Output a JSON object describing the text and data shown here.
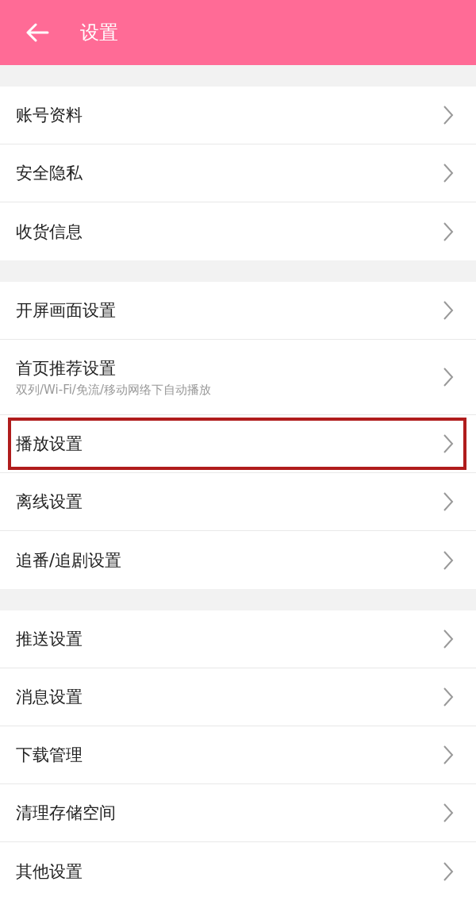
{
  "header": {
    "title": "设置"
  },
  "groups": [
    {
      "items": [
        {
          "label": "账号资料",
          "highlighted": false
        },
        {
          "label": "安全隐私",
          "highlighted": false
        },
        {
          "label": "收货信息",
          "highlighted": false
        }
      ]
    },
    {
      "items": [
        {
          "label": "开屏画面设置",
          "highlighted": false
        },
        {
          "label": "首页推荐设置",
          "subtitle": "双列/Wi-Fi/免流/移动网络下自动播放",
          "highlighted": false
        },
        {
          "label": "播放设置",
          "highlighted": true
        },
        {
          "label": "离线设置",
          "highlighted": false
        },
        {
          "label": "追番/追剧设置",
          "highlighted": false
        }
      ]
    },
    {
      "items": [
        {
          "label": "推送设置",
          "highlighted": false
        },
        {
          "label": "消息设置",
          "highlighted": false
        },
        {
          "label": "下载管理",
          "highlighted": false
        },
        {
          "label": "清理存储空间",
          "highlighted": false
        },
        {
          "label": "其他设置",
          "highlighted": false
        }
      ]
    }
  ]
}
